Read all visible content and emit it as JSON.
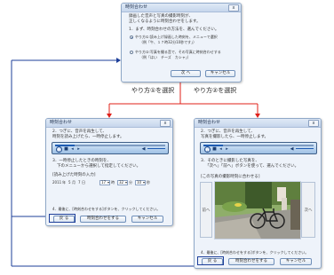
{
  "window_title": "時刻合わせ",
  "close_glyph": "x",
  "dialog_top": {
    "intro_line1": "録画した音声と写真の撮影時刻が、",
    "intro_line2": "正しくなるように時刻合わせをします。",
    "step1": "1．まず、時刻合わせの方法を、選んでください。",
    "option1_line1": "やり方①:読み上げ録画した時刻を、メニューで選択",
    "option1_line2": "（例「午、１７時32分10秒です」）",
    "option2_line1": "やり方②:写真を撮る音で、その写真に時刻合わせする",
    "option2_line2": "（例「はい　チーズ　カシャ」）",
    "next_button": "次 へ",
    "cancel_button": "キャンセル"
  },
  "label_left": "やり方①を選択",
  "label_right": "やり方②を選択",
  "dialog_left": {
    "step2_line1": "2．つぎに、音声を再生して、",
    "step2_line2": "時刻を読み上げたら、一時停止します。",
    "step3_line1": "3．一時停止したときの時刻を、",
    "step3_line2": "下のメニューから選択して指定してください。",
    "time_heading": "[読み上げた時刻の入力]",
    "year_value": "2011",
    "year_unit": "年",
    "month_value": "5",
    "month_unit": "月",
    "day_value": "7",
    "day_unit": "日",
    "hour_value": "17",
    "hour_unit": "時",
    "minute_value": "32",
    "minute_unit": "分",
    "second_value": "10",
    "second_unit": "秒",
    "step4": "4．最後に、[時刻合わせをする]ボタンを、クリックしてください。",
    "back_button": "戻 る",
    "sync_button": "時刻合わせをする",
    "cancel_button": "キャンセル"
  },
  "dialog_right": {
    "step2_line1": "2．つぎに、音声を再生して、",
    "step2_line2": "写真を撮影したら、一時停止します。",
    "step3_line1": "3．そのときに撮影した写真を、",
    "step3_line2": "「次へ」「前へ」ボタンを使って、選んでください。",
    "photo_caption": "[この写真の撮影時刻に合わせる]",
    "prev_button": "前へ",
    "next_button": "次へ",
    "step4": "4．最後に、[時刻合わせをする]ボタンを、クリックしてください。",
    "back_button": "戻 る",
    "sync_button": "時刻合わせをする",
    "cancel_button": "キャンセル"
  },
  "colors": {
    "arrow_red": "#e0201a",
    "arrow_blue": "#1e3f9a",
    "dialog_bg": "#eef3fa"
  }
}
